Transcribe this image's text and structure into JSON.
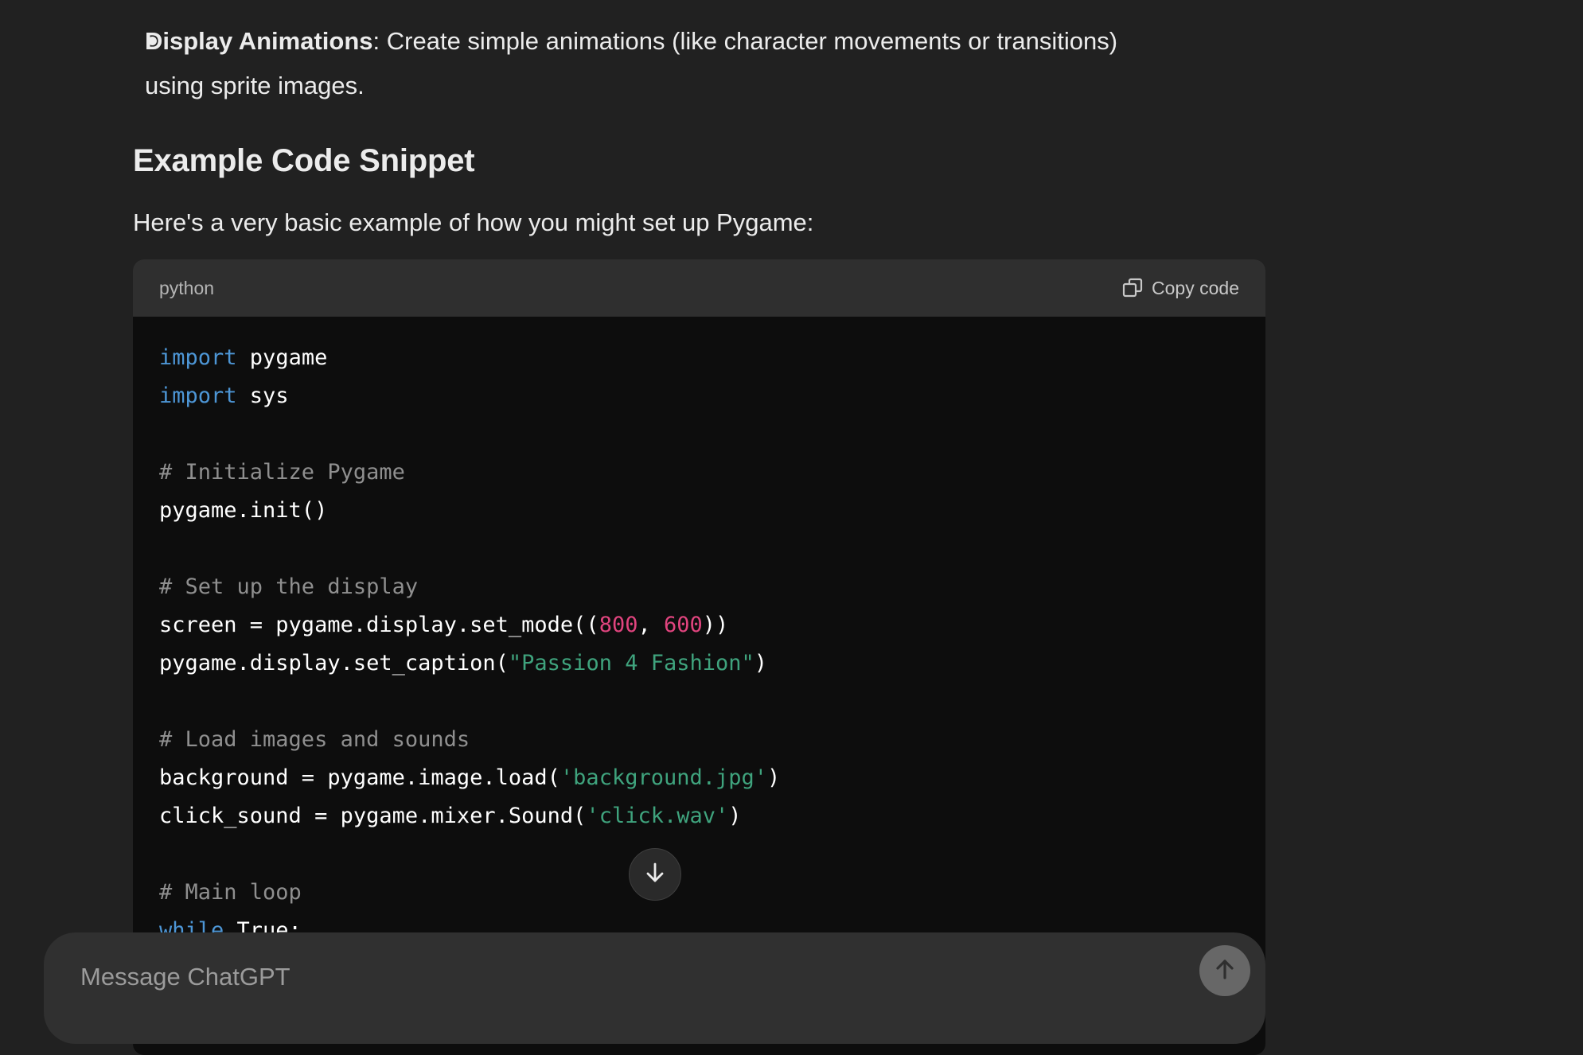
{
  "message": {
    "bullet": {
      "title": "Display Animations",
      "separator": ":",
      "text_line1": " Create simple animations (like character movements or transitions)",
      "text_line2": "using sprite images."
    },
    "heading": "Example Code Snippet",
    "intro": "Here's a very basic example of how you might set up Pygame:"
  },
  "code_block": {
    "language": "python",
    "copy_label": "Copy code",
    "lines": {
      "l1_kw": "import",
      "l1_rest": " pygame",
      "l2_kw": "import",
      "l2_rest": " sys",
      "l4_comment": "# Initialize Pygame",
      "l5": "pygame.init()",
      "l7_comment": "# Set up the display",
      "l8_a": "screen = pygame.display.set_mode((",
      "l8_n1": "800",
      "l8_b": ", ",
      "l8_n2": "600",
      "l8_c": "))",
      "l9_a": "pygame.display.set_caption(",
      "l9_str": "\"Passion 4 Fashion\"",
      "l9_c": ")",
      "l11_comment": "# Load images and sounds",
      "l12_a": "background = pygame.image.load(",
      "l12_str": "'background.jpg'",
      "l12_c": ")",
      "l13_a": "click_sound = pygame.mixer.Sound(",
      "l13_str": "'click.wav'",
      "l13_c": ")",
      "l15_comment": "# Main loop",
      "l16_kw": "while",
      "l16_rest": " True:"
    }
  },
  "scroll_button": {
    "icon": "arrow-down-icon"
  },
  "composer": {
    "placeholder": "Message ChatGPT",
    "send_icon": "arrow-up-icon"
  },
  "colors": {
    "background": "#212121",
    "code_background": "#0d0d0d",
    "code_header": "#2f2f2f",
    "keyword": "#4d96d6",
    "comment": "#8f8f8f",
    "number": "#e0447e",
    "string": "#3fa37d"
  }
}
